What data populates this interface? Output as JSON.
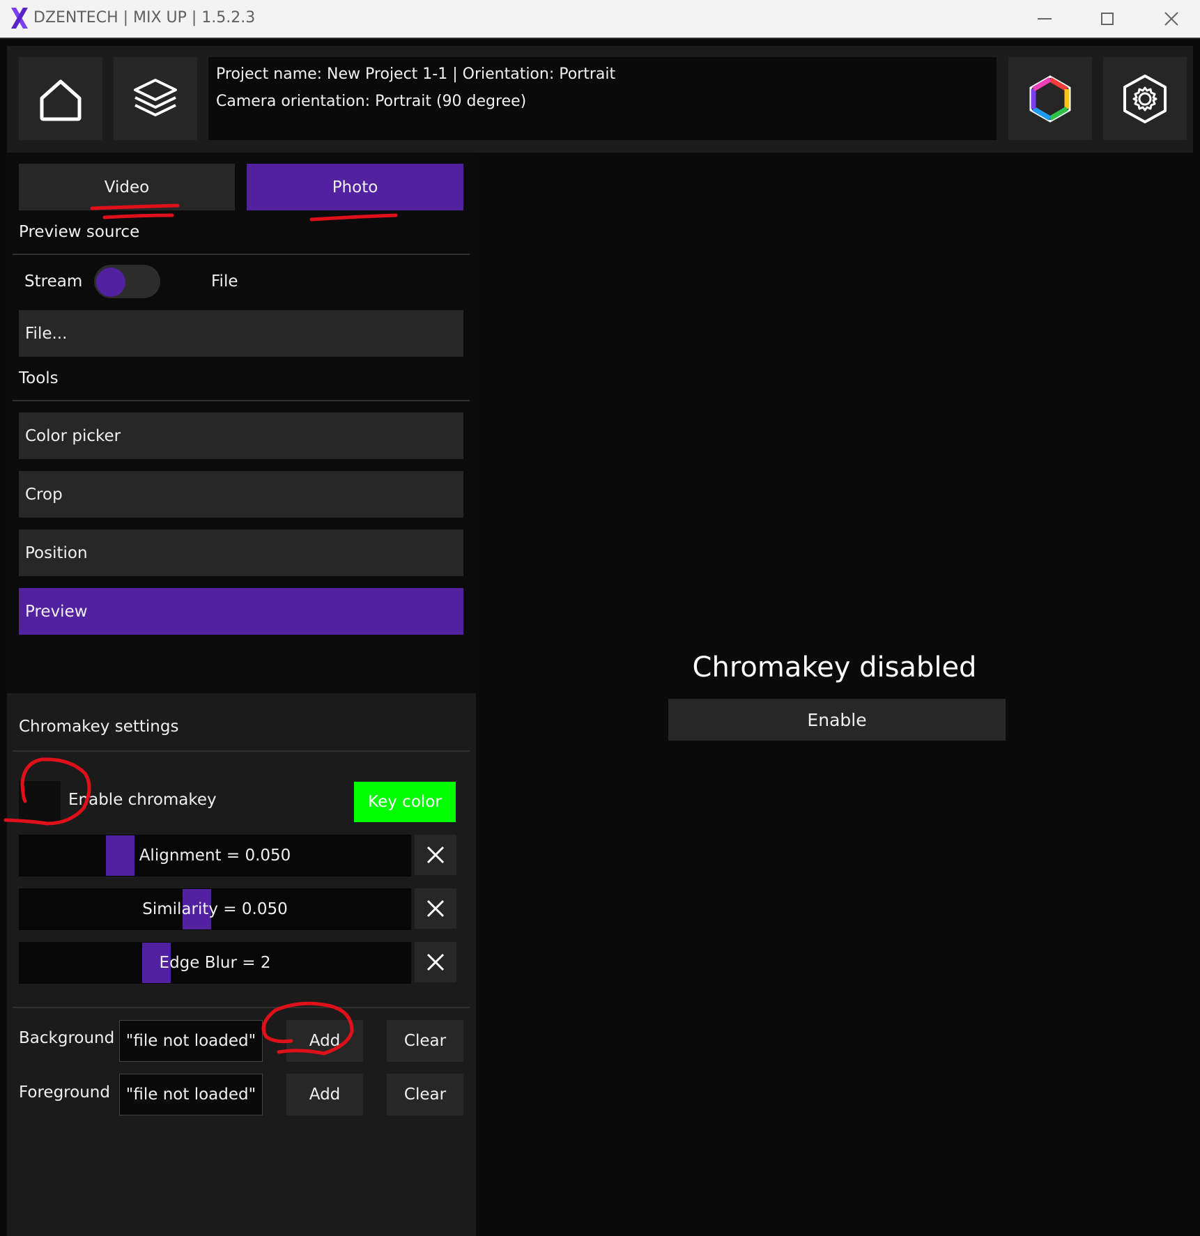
{
  "window": {
    "title": "DZENTECH | MIX UP | 1.5.2.3",
    "logo_icon": "x-logo-icon",
    "controls": [
      "minimize-icon",
      "maximize-icon",
      "close-icon"
    ]
  },
  "header": {
    "project_line": "Project name: New Project 1-1 | Orientation: Portrait",
    "camera_line": "Camera orientation: Portrait (90 degree)",
    "left_buttons": [
      "home-icon",
      "layers-icon"
    ],
    "right_buttons": [
      "color-hexagon-icon",
      "settings-gear-icon"
    ]
  },
  "mode_tabs": [
    {
      "label": "Video",
      "active": false
    },
    {
      "label": "Photo",
      "active": true
    }
  ],
  "preview_source": {
    "title": "Preview source",
    "left_option": "Stream",
    "right_option": "File",
    "toggle_position": "stream",
    "file_button": "File..."
  },
  "tools": {
    "title": "Tools",
    "items": [
      {
        "label": "Color picker",
        "active": false
      },
      {
        "label": "Crop",
        "active": false
      },
      {
        "label": "Position",
        "active": false
      },
      {
        "label": "Preview",
        "active": true
      }
    ]
  },
  "chromakey": {
    "title": "Chromakey settings",
    "enable_label": "Enable chromakey",
    "enabled": false,
    "key_color_label": "Key color",
    "key_color": "#00ff00",
    "sliders": [
      {
        "label": "Alignment = 0.050",
        "position": 0.24
      },
      {
        "label": "Similarity = 0.050",
        "position": 0.45
      },
      {
        "label": "Edge Blur = 2",
        "position": 0.34
      }
    ],
    "layers": [
      {
        "label": "Background",
        "file": "\"file not loaded\"",
        "add": "Add",
        "clear": "Clear"
      },
      {
        "label": "Foreground",
        "file": "\"file not loaded\"",
        "add": "Add",
        "clear": "Clear"
      }
    ]
  },
  "preview_area": {
    "message": "Chromakey disabled",
    "enable_button": "Enable"
  },
  "colors": {
    "accent": "#5121a0",
    "key_green": "#00ff00",
    "annotation_red": "#e0101a"
  }
}
